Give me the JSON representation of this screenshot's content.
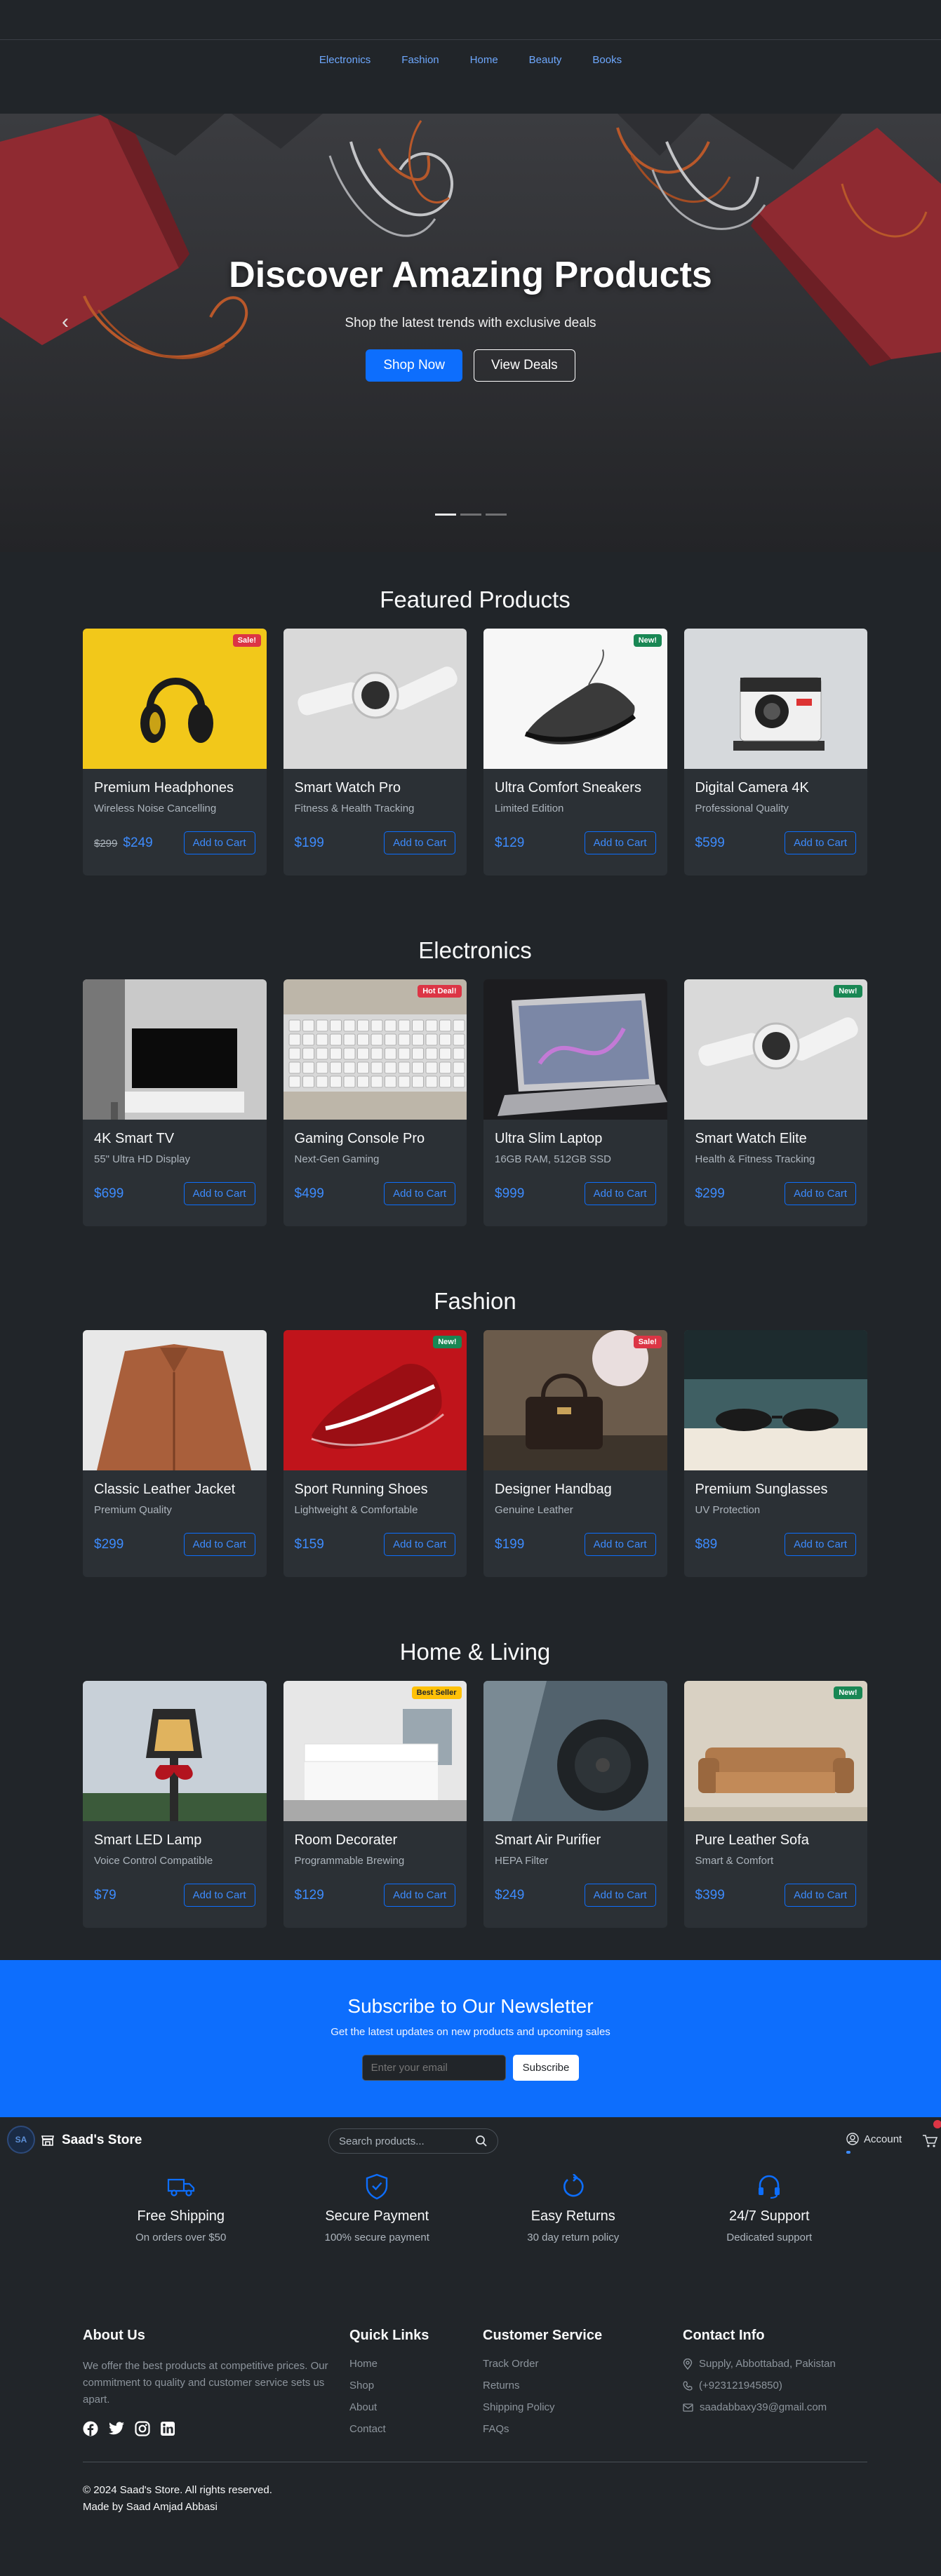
{
  "nav": {
    "links": [
      "Electronics",
      "Fashion",
      "Home",
      "Beauty",
      "Books"
    ]
  },
  "hero": {
    "title": "Discover Amazing Products",
    "subtitle": "Shop the latest trends with exclusive deals",
    "primary_button": "Shop Now",
    "secondary_button": "View Deals",
    "slides": 3,
    "active_slide": 1
  },
  "sections": [
    {
      "title": "Featured Products",
      "products": [
        {
          "name": "Premium Headphones",
          "subtitle": "Wireless Noise Cancelling",
          "old_price": "$299",
          "price": "$249",
          "badge": "Sale!",
          "badge_color": "#dc3545",
          "icon": "headphones-image",
          "button": "Add to Cart"
        },
        {
          "name": "Smart Watch Pro",
          "subtitle": "Fitness & Health Tracking",
          "old_price": "",
          "price": "$199",
          "badge": "",
          "badge_color": "",
          "icon": "smartwatch-image",
          "button": "Add to Cart"
        },
        {
          "name": "Ultra Comfort Sneakers",
          "subtitle": "Limited Edition",
          "old_price": "",
          "price": "$129",
          "badge": "New!",
          "badge_color": "#198754",
          "icon": "sneaker-image",
          "button": "Add to Cart"
        },
        {
          "name": "Digital Camera 4K",
          "subtitle": "Professional Quality",
          "old_price": "",
          "price": "$599",
          "badge": "",
          "badge_color": "",
          "icon": "camera-image",
          "button": "Add to Cart"
        }
      ]
    },
    {
      "title": "Electronics",
      "products": [
        {
          "name": "4K Smart TV",
          "subtitle": "55\" Ultra HD Display",
          "old_price": "",
          "price": "$699",
          "badge": "",
          "badge_color": "",
          "icon": "tv-image",
          "button": "Add to Cart"
        },
        {
          "name": "Gaming Console Pro",
          "subtitle": "Next-Gen Gaming",
          "old_price": "",
          "price": "$499",
          "badge": "Hot Deal!",
          "badge_color": "#dc3545",
          "icon": "keyboard-image",
          "button": "Add to Cart"
        },
        {
          "name": "Ultra Slim Laptop",
          "subtitle": "16GB RAM, 512GB SSD",
          "old_price": "",
          "price": "$999",
          "badge": "",
          "badge_color": "",
          "icon": "laptop-image",
          "button": "Add to Cart"
        },
        {
          "name": "Smart Watch Elite",
          "subtitle": "Health & Fitness Tracking",
          "old_price": "",
          "price": "$299",
          "badge": "New!",
          "badge_color": "#198754",
          "icon": "smartwatch-image",
          "button": "Add to Cart"
        }
      ]
    },
    {
      "title": "Fashion",
      "products": [
        {
          "name": "Classic Leather Jacket",
          "subtitle": "Premium Quality",
          "old_price": "",
          "price": "$299",
          "badge": "",
          "badge_color": "",
          "icon": "jacket-image",
          "button": "Add to Cart"
        },
        {
          "name": "Sport Running Shoes",
          "subtitle": "Lightweight & Comfortable",
          "old_price": "",
          "price": "$159",
          "badge": "New!",
          "badge_color": "#198754",
          "icon": "running-shoe-image",
          "button": "Add to Cart"
        },
        {
          "name": "Designer Handbag",
          "subtitle": "Genuine Leather",
          "old_price": "",
          "price": "$199",
          "badge": "Sale!",
          "badge_color": "#dc3545",
          "icon": "handbag-image",
          "button": "Add to Cart"
        },
        {
          "name": "Premium Sunglasses",
          "subtitle": "UV Protection",
          "old_price": "",
          "price": "$89",
          "badge": "",
          "badge_color": "",
          "icon": "sunglasses-image",
          "button": "Add to Cart"
        }
      ]
    },
    {
      "title": "Home & Living",
      "products": [
        {
          "name": "Smart LED Lamp",
          "subtitle": "Voice Control Compatible",
          "old_price": "",
          "price": "$79",
          "badge": "",
          "badge_color": "",
          "icon": "lamp-image",
          "button": "Add to Cart"
        },
        {
          "name": "Room Decorater",
          "subtitle": "Programmable Brewing",
          "old_price": "",
          "price": "$129",
          "badge": "Best Seller",
          "badge_color": "#ffc107",
          "icon": "bedroom-image",
          "button": "Add to Cart"
        },
        {
          "name": "Smart Air Purifier",
          "subtitle": "HEPA Filter",
          "old_price": "",
          "price": "$249",
          "badge": "",
          "badge_color": "",
          "icon": "robot-vacuum-image",
          "button": "Add to Cart"
        },
        {
          "name": "Pure Leather Sofa",
          "subtitle": "Smart & Comfort",
          "old_price": "",
          "price": "$399",
          "badge": "New!",
          "badge_color": "#198754",
          "icon": "sofa-image",
          "button": "Add to Cart"
        }
      ]
    }
  ],
  "newsletter": {
    "title": "Subscribe to Our Newsletter",
    "subtitle": "Get the latest updates on new products and upcoming sales",
    "placeholder": "Enter your email",
    "button": "Subscribe"
  },
  "navbar": {
    "brand": "Saad's Store",
    "search_placeholder": "Search products...",
    "account": "Account"
  },
  "features": [
    {
      "title": "Free Shipping",
      "text": "On orders over $50",
      "icon": "truck-icon"
    },
    {
      "title": "Secure Payment",
      "text": "100% secure payment",
      "icon": "shield-icon"
    },
    {
      "title": "Easy Returns",
      "text": "30 day return policy",
      "icon": "return-icon"
    },
    {
      "title": "24/7 Support",
      "text": "Dedicated support",
      "icon": "headset-icon"
    }
  ],
  "footer": {
    "about_title": "About Us",
    "about_text": "We offer the best products at competitive prices. Our commitment to quality and customer service sets us apart.",
    "quick_links_title": "Quick Links",
    "quick_links": [
      "Home",
      "Shop",
      "About",
      "Contact"
    ],
    "service_title": "Customer Service",
    "service_links": [
      "Track Order",
      "Returns",
      "Shipping Policy",
      "FAQs"
    ],
    "contact_title": "Contact Info",
    "contact": {
      "address": "Supply, Abbottabad, Pakistan",
      "phone": "(+923121945850)",
      "email": "saadabbaxy39@gmail.com"
    },
    "copyright": "© 2024 Saad's Store. All rights reserved.",
    "made_by": "Made by Saad Amjad Abbasi"
  },
  "colors": {
    "accent": "#0d6efd",
    "background": "#212529",
    "card": "#2b3035"
  }
}
